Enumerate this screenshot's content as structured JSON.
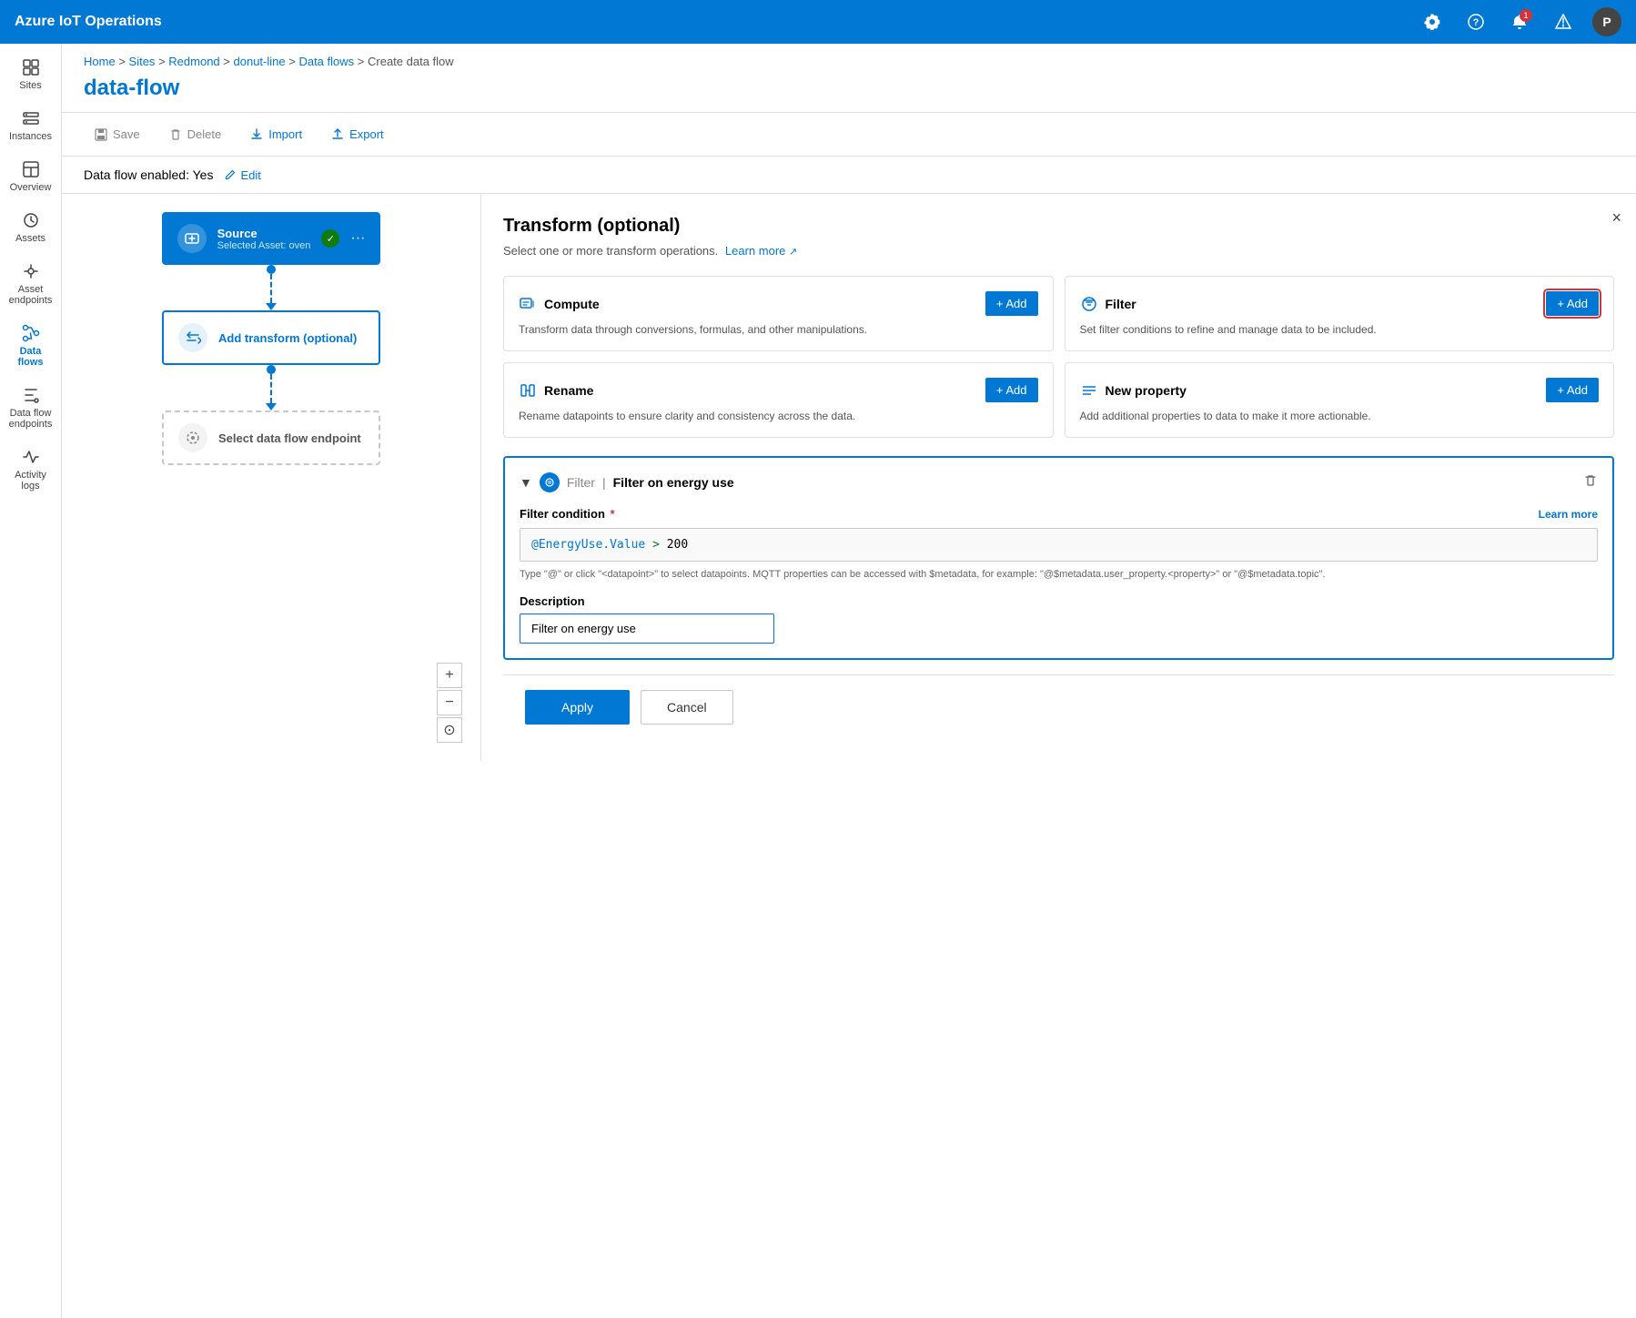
{
  "app": {
    "title": "Azure IoT Operations"
  },
  "topnav": {
    "title": "Azure IoT Operations",
    "notification_count": "1",
    "avatar_label": "P"
  },
  "sidebar": {
    "items": [
      {
        "id": "sites",
        "label": "Sites",
        "icon": "grid-icon",
        "active": false
      },
      {
        "id": "instances",
        "label": "Instances",
        "icon": "instances-icon",
        "active": false
      },
      {
        "id": "overview",
        "label": "Overview",
        "icon": "overview-icon",
        "active": false
      },
      {
        "id": "assets",
        "label": "Assets",
        "icon": "assets-icon",
        "active": false
      },
      {
        "id": "asset-endpoints",
        "label": "Asset endpoints",
        "icon": "endpoints-icon",
        "active": false
      },
      {
        "id": "data-flows",
        "label": "Data flows",
        "icon": "dataflow-icon",
        "active": true
      },
      {
        "id": "data-flow-endpoints",
        "label": "Data flow endpoints",
        "icon": "flow-endpoints-icon",
        "active": false
      },
      {
        "id": "activity-logs",
        "label": "Activity logs",
        "icon": "activity-icon",
        "active": false
      }
    ]
  },
  "breadcrumb": {
    "parts": [
      "Home",
      "Sites",
      "Redmond",
      "donut-line",
      "Data flows",
      "Create data flow"
    ],
    "separator": ">"
  },
  "page": {
    "title": "data-flow"
  },
  "toolbar": {
    "save_label": "Save",
    "delete_label": "Delete",
    "import_label": "Import",
    "export_label": "Export"
  },
  "status_bar": {
    "label": "Data flow enabled: Yes",
    "edit_label": "Edit"
  },
  "flow": {
    "source_title": "Source",
    "source_sub": "Selected Asset: oven",
    "transform_title": "Add transform (optional)",
    "endpoint_title": "Select data flow endpoint",
    "zoom_in": "+",
    "zoom_out": "−",
    "zoom_reset": "⊙"
  },
  "transform_panel": {
    "title": "Transform (optional)",
    "subtitle": "Select one or more transform operations.",
    "learn_more": "Learn more",
    "close_label": "×",
    "operations": [
      {
        "id": "compute",
        "title": "Compute",
        "description": "Transform data through conversions, formulas, and other manipulations.",
        "add_label": "+ Add"
      },
      {
        "id": "filter",
        "title": "Filter",
        "description": "Set filter conditions to refine and manage data to be included.",
        "add_label": "+ Add",
        "highlighted": true
      },
      {
        "id": "rename",
        "title": "Rename",
        "description": "Rename datapoints to ensure clarity and consistency across the data.",
        "add_label": "+ Add"
      },
      {
        "id": "new-property",
        "title": "New property",
        "description": "Add additional properties to data to make it more actionable.",
        "add_label": "+ Add"
      }
    ]
  },
  "filter_section": {
    "name": "Filter on energy use",
    "condition_label": "Filter condition",
    "condition_required": "*",
    "learn_more": "Learn more",
    "condition_value": "@EnergyUse.Value > 200",
    "hint": "Type \"@\" or click \"<datapoint>\" to select datapoints. MQTT properties can be accessed with $metadata, for example: \"@$metadata.user_property.<property>\" or \"@$metadata.topic\".",
    "description_label": "Description",
    "description_value": "Filter on energy use"
  },
  "actions": {
    "apply_label": "Apply",
    "cancel_label": "Cancel"
  }
}
